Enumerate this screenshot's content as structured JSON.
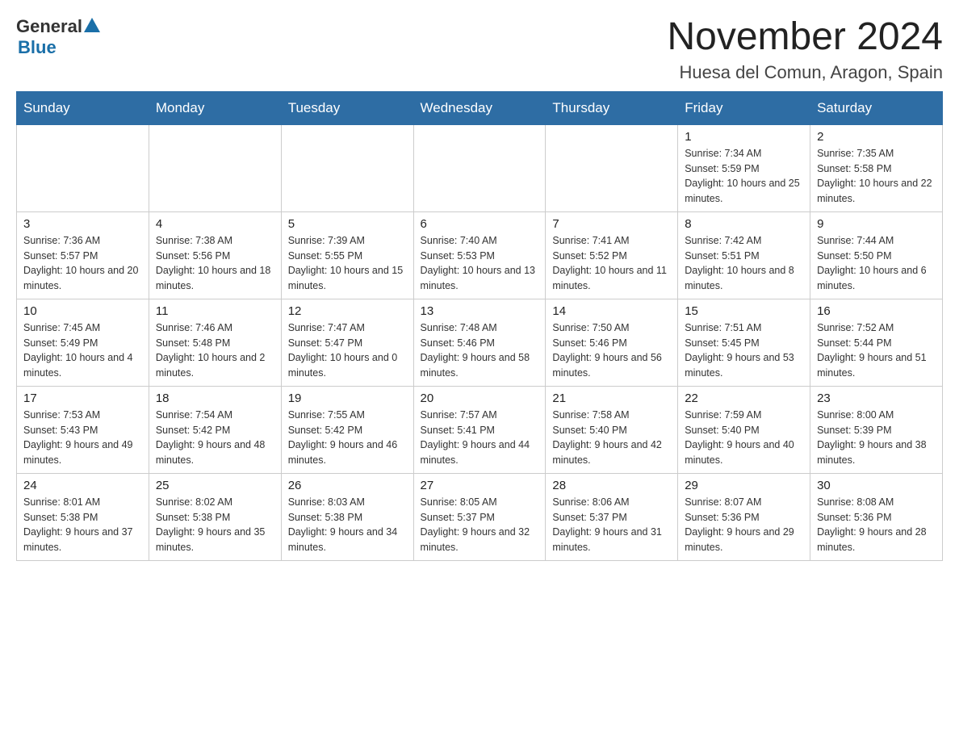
{
  "header": {
    "month_title": "November 2024",
    "location": "Huesa del Comun, Aragon, Spain",
    "logo_general": "General",
    "logo_blue": "Blue"
  },
  "weekdays": [
    "Sunday",
    "Monday",
    "Tuesday",
    "Wednesday",
    "Thursday",
    "Friday",
    "Saturday"
  ],
  "weeks": [
    [
      {
        "day": "",
        "info": ""
      },
      {
        "day": "",
        "info": ""
      },
      {
        "day": "",
        "info": ""
      },
      {
        "day": "",
        "info": ""
      },
      {
        "day": "",
        "info": ""
      },
      {
        "day": "1",
        "info": "Sunrise: 7:34 AM\nSunset: 5:59 PM\nDaylight: 10 hours and 25 minutes."
      },
      {
        "day": "2",
        "info": "Sunrise: 7:35 AM\nSunset: 5:58 PM\nDaylight: 10 hours and 22 minutes."
      }
    ],
    [
      {
        "day": "3",
        "info": "Sunrise: 7:36 AM\nSunset: 5:57 PM\nDaylight: 10 hours and 20 minutes."
      },
      {
        "day": "4",
        "info": "Sunrise: 7:38 AM\nSunset: 5:56 PM\nDaylight: 10 hours and 18 minutes."
      },
      {
        "day": "5",
        "info": "Sunrise: 7:39 AM\nSunset: 5:55 PM\nDaylight: 10 hours and 15 minutes."
      },
      {
        "day": "6",
        "info": "Sunrise: 7:40 AM\nSunset: 5:53 PM\nDaylight: 10 hours and 13 minutes."
      },
      {
        "day": "7",
        "info": "Sunrise: 7:41 AM\nSunset: 5:52 PM\nDaylight: 10 hours and 11 minutes."
      },
      {
        "day": "8",
        "info": "Sunrise: 7:42 AM\nSunset: 5:51 PM\nDaylight: 10 hours and 8 minutes."
      },
      {
        "day": "9",
        "info": "Sunrise: 7:44 AM\nSunset: 5:50 PM\nDaylight: 10 hours and 6 minutes."
      }
    ],
    [
      {
        "day": "10",
        "info": "Sunrise: 7:45 AM\nSunset: 5:49 PM\nDaylight: 10 hours and 4 minutes."
      },
      {
        "day": "11",
        "info": "Sunrise: 7:46 AM\nSunset: 5:48 PM\nDaylight: 10 hours and 2 minutes."
      },
      {
        "day": "12",
        "info": "Sunrise: 7:47 AM\nSunset: 5:47 PM\nDaylight: 10 hours and 0 minutes."
      },
      {
        "day": "13",
        "info": "Sunrise: 7:48 AM\nSunset: 5:46 PM\nDaylight: 9 hours and 58 minutes."
      },
      {
        "day": "14",
        "info": "Sunrise: 7:50 AM\nSunset: 5:46 PM\nDaylight: 9 hours and 56 minutes."
      },
      {
        "day": "15",
        "info": "Sunrise: 7:51 AM\nSunset: 5:45 PM\nDaylight: 9 hours and 53 minutes."
      },
      {
        "day": "16",
        "info": "Sunrise: 7:52 AM\nSunset: 5:44 PM\nDaylight: 9 hours and 51 minutes."
      }
    ],
    [
      {
        "day": "17",
        "info": "Sunrise: 7:53 AM\nSunset: 5:43 PM\nDaylight: 9 hours and 49 minutes."
      },
      {
        "day": "18",
        "info": "Sunrise: 7:54 AM\nSunset: 5:42 PM\nDaylight: 9 hours and 48 minutes."
      },
      {
        "day": "19",
        "info": "Sunrise: 7:55 AM\nSunset: 5:42 PM\nDaylight: 9 hours and 46 minutes."
      },
      {
        "day": "20",
        "info": "Sunrise: 7:57 AM\nSunset: 5:41 PM\nDaylight: 9 hours and 44 minutes."
      },
      {
        "day": "21",
        "info": "Sunrise: 7:58 AM\nSunset: 5:40 PM\nDaylight: 9 hours and 42 minutes."
      },
      {
        "day": "22",
        "info": "Sunrise: 7:59 AM\nSunset: 5:40 PM\nDaylight: 9 hours and 40 minutes."
      },
      {
        "day": "23",
        "info": "Sunrise: 8:00 AM\nSunset: 5:39 PM\nDaylight: 9 hours and 38 minutes."
      }
    ],
    [
      {
        "day": "24",
        "info": "Sunrise: 8:01 AM\nSunset: 5:38 PM\nDaylight: 9 hours and 37 minutes."
      },
      {
        "day": "25",
        "info": "Sunrise: 8:02 AM\nSunset: 5:38 PM\nDaylight: 9 hours and 35 minutes."
      },
      {
        "day": "26",
        "info": "Sunrise: 8:03 AM\nSunset: 5:38 PM\nDaylight: 9 hours and 34 minutes."
      },
      {
        "day": "27",
        "info": "Sunrise: 8:05 AM\nSunset: 5:37 PM\nDaylight: 9 hours and 32 minutes."
      },
      {
        "day": "28",
        "info": "Sunrise: 8:06 AM\nSunset: 5:37 PM\nDaylight: 9 hours and 31 minutes."
      },
      {
        "day": "29",
        "info": "Sunrise: 8:07 AM\nSunset: 5:36 PM\nDaylight: 9 hours and 29 minutes."
      },
      {
        "day": "30",
        "info": "Sunrise: 8:08 AM\nSunset: 5:36 PM\nDaylight: 9 hours and 28 minutes."
      }
    ]
  ]
}
